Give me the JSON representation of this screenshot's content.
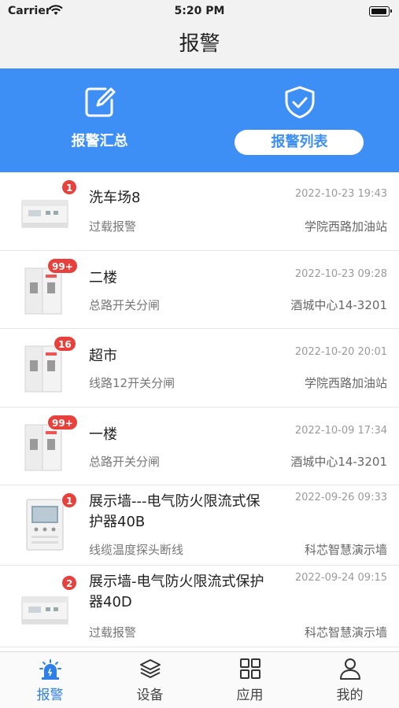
{
  "status_bar": {
    "carrier": "Carrier",
    "time": "5:20 PM"
  },
  "nav": {
    "title": "报警"
  },
  "header_tabs": [
    {
      "label": "报警汇总",
      "icon": "edit-icon",
      "selected": false
    },
    {
      "label": "报警列表",
      "icon": "shield-check-icon",
      "selected": true
    }
  ],
  "alarms": [
    {
      "name": "洗车场8",
      "time": "2022-10-23 19:43",
      "type": "过载报警",
      "location": "学院西路加油站",
      "badge": "1",
      "device": "meter"
    },
    {
      "name": "二楼",
      "time": "2022-10-23 09:28",
      "type": "总路开关分闸",
      "location": "酒城中心14-3201",
      "badge": "99+",
      "device": "breaker"
    },
    {
      "name": "超市",
      "time": "2022-10-20 20:01",
      "type": "线路12开关分闸",
      "location": "学院西路加油站",
      "badge": "16",
      "device": "breaker"
    },
    {
      "name": "一楼",
      "time": "2022-10-09 17:34",
      "type": "总路开关分闸",
      "location": "酒城中心14-3201",
      "badge": "99+",
      "device": "breaker"
    },
    {
      "name": "展示墙---电气防火限流式保护器40B",
      "time": "2022-09-26 09:33",
      "type": "线缆温度探头断线",
      "location": "科芯智慧演示墙",
      "badge": "1",
      "device": "panel"
    },
    {
      "name": "展示墙-电气防火限流式保护器40D",
      "time": "2022-09-24 09:15",
      "type": "过载报警",
      "location": "科芯智慧演示墙",
      "badge": "2",
      "device": "meter"
    }
  ],
  "tabbar": [
    {
      "label": "报警",
      "icon": "alarm-light-icon",
      "active": true
    },
    {
      "label": "设备",
      "icon": "layers-icon",
      "active": false
    },
    {
      "label": "应用",
      "icon": "grid-icon",
      "active": false
    },
    {
      "label": "我的",
      "icon": "person-icon",
      "active": false
    }
  ],
  "colors": {
    "accent": "#3d8ff5",
    "badge": "#e8403a",
    "active_tab": "#2f7fe8"
  }
}
